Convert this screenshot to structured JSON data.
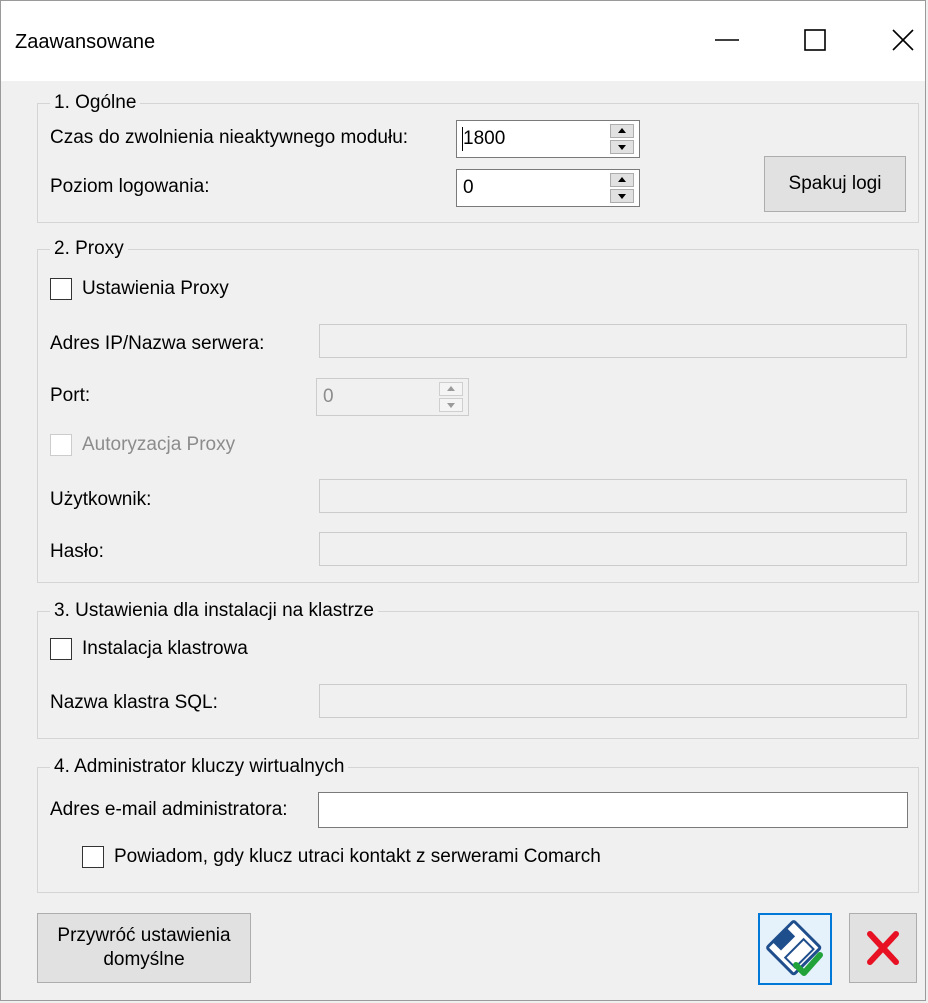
{
  "window": {
    "title": "Zaawansowane",
    "minimize_icon": "minimize-icon",
    "maximize_icon": "maximize-icon",
    "close_icon": "close-icon"
  },
  "general": {
    "legend": "1. Ogólne",
    "timeout_label": "Czas do zwolnienia nieaktywnego modułu:",
    "timeout_value": "1800",
    "log_level_label": "Poziom logowania:",
    "log_level_value": "0",
    "pack_logs_button": "Spakuj logi"
  },
  "proxy": {
    "legend": "2. Proxy",
    "enable_label": "Ustawienia Proxy",
    "address_label": "Adres IP/Nazwa serwera:",
    "address_value": "",
    "port_label": "Port:",
    "port_value": "0",
    "auth_label": "Autoryzacja Proxy",
    "user_label": "Użytkownik:",
    "user_value": "",
    "password_label": "Hasło:",
    "password_value": ""
  },
  "cluster": {
    "legend": "3. Ustawienia dla instalacji na klastrze",
    "enable_label": "Instalacja klastrowa",
    "sql_cluster_label": "Nazwa klastra SQL:",
    "sql_cluster_value": ""
  },
  "admin": {
    "legend": "4. Administrator kluczy wirtualnych",
    "email_label": "Adres e-mail administratora:",
    "email_value": "",
    "notify_label": "Powiadom, gdy klucz utraci kontakt z serwerami Comarch"
  },
  "footer": {
    "restore_line1": "Przywróć ustawienia",
    "restore_line2": "domyślne",
    "save_icon": "save-icon",
    "cancel_icon": "cancel-icon"
  },
  "colors": {
    "accent_border": "#0078d7",
    "cancel_red": "#e81123",
    "save_check_green": "#22a33a"
  }
}
